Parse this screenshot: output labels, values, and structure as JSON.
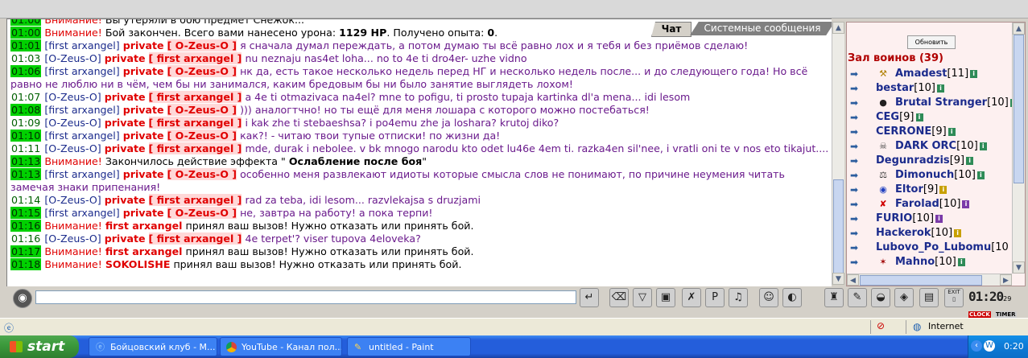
{
  "chat": {
    "tabs": {
      "chat": "Чат",
      "system": "Системные сообщения"
    },
    "lines": [
      {
        "time": "01:00",
        "warn": "Внимание!",
        "text": "Вы утеряли в бою предмет Снежок..."
      },
      {
        "time": "01:00",
        "warn": "Внимание!",
        "text_a": "Бой закончен. Всего вами нанесено урона:",
        "bold_a": "1129 HP",
        "text_b": ". Получено опыта:",
        "bold_b": "0",
        "text_c": "."
      },
      {
        "time": "01:01",
        "from": "[first arxangel]",
        "priv": "private",
        "to": "[ O-Zeus-O ]",
        "msg": "я сначала думал переждать, а потом думаю ты всё равно лох и я тебя и без приёмов сделаю!"
      },
      {
        "time": "01:03",
        "from": "[O-Zeus-O]",
        "priv": "private",
        "to": "[ first arxangel ]",
        "msg": "nu neznaju nas4et loha... no to 4e ti dro4er- uzhe vidno"
      },
      {
        "time": "01:06",
        "from": "[first arxangel]",
        "priv": "private",
        "to": "[ O-Zeus-O ]",
        "msg": "нк да, есть такое несколько недель перед НГ и несколько недель после... и до следующего года! Но всё равно не люблю ни в чём, чем бы ни занимался, каким бредовым бы ни было занятие выглядеть лохом!"
      },
      {
        "time": "01:07",
        "from": "[O-Zeus-O]",
        "priv": "private",
        "to": "[ first arxangel ]",
        "msg": "a 4e ti otmazivaca na4el? mne to pofigu, ti prosto tupaja kartinka dl'a mena... idi lesom"
      },
      {
        "time": "01:08",
        "from": "[first arxangel]",
        "priv": "private",
        "to": "[ O-Zeus-O ]",
        "msg": "))) аналогтчно! но ты ещё для меня лошара с которого можно постебаться!"
      },
      {
        "time": "01:09",
        "from": "[O-Zeus-O]",
        "priv": "private",
        "to": "[ first arxangel ]",
        "msg": "i kak zhe ti stebaeshsa? i po4emu zhe ja loshara? krutoj diko?"
      },
      {
        "time": "01:10",
        "from": "[first arxangel]",
        "priv": "private",
        "to": "[ O-Zeus-O ]",
        "msg": "как?! - читаю твои тупые отписки! по жизни да!"
      },
      {
        "time": "01:11",
        "from": "[O-Zeus-O]",
        "priv": "private",
        "to": "[ first arxangel ]",
        "msg": "mde, durak i nebolee. v bk mnogo narodu kto odet lu46e 4em ti. razka4en sil'nee, i vratli oni te v nos eto tikajut...."
      },
      {
        "time": "01:13",
        "warn": "Внимание!",
        "text_a": "Закончилось действие эффекта \"",
        "bold_a": "Ослабление после боя",
        "text_b": "\""
      },
      {
        "time": "01:13",
        "from": "[first arxangel]",
        "priv": "private",
        "to": "[ O-Zeus-O ]",
        "msg": "особенно меня развлекают идиоты которые смысла слов не понимают, по причине неумения читать замечая знаки припенания!"
      },
      {
        "time": "01:14",
        "from": "[O-Zeus-O]",
        "priv": "private",
        "to": "[ first arxangel ]",
        "msg": "rad za teba, idi lesom... razvlekajsa s druzjami"
      },
      {
        "time": "01:15",
        "from": "[first arxangel]",
        "priv": "private",
        "to": "[ O-Zeus-O ]",
        "msg": "не, завтра на работу! а пока терпи!"
      },
      {
        "time": "01:16",
        "warn": "Внимание!",
        "who": "first arxangel",
        "text_a": "принял ваш вызов! Нужно отказать или принять бой."
      },
      {
        "time": "01:16",
        "from": "[O-Zeus-O]",
        "priv": "private",
        "to": "[ first arxangel ]",
        "msg": "4e terpet'? viser tupova 4eloveka?"
      },
      {
        "time": "01:17",
        "warn": "Внимание!",
        "who": "first arxangel",
        "text_a": "принял ваш вызов! Нужно отказать или принять бой."
      },
      {
        "time": "01:18",
        "warn": "Внимание!",
        "who": "SOKOLISHE",
        "text_a": "принял ваш вызов! Нужно отказать или принять бой."
      }
    ]
  },
  "room": {
    "refresh_label": "Обновить",
    "title": "Зал воинов (39)",
    "users": [
      {
        "name": "Amadest",
        "level": "[11]"
      },
      {
        "name": "bestar",
        "level": "[10]"
      },
      {
        "name": "Brutal Stranger",
        "level": "[10]"
      },
      {
        "name": "CEG",
        "level": "[9]"
      },
      {
        "name": "CERRONE",
        "level": "[9]"
      },
      {
        "name": "DARK ORC",
        "level": "[10]"
      },
      {
        "name": "Degunradzis",
        "level": "[9]"
      },
      {
        "name": "Dimonuch",
        "level": "[10]"
      },
      {
        "name": "Eltor",
        "level": "[9]"
      },
      {
        "name": "Farolad",
        "level": "[10]"
      },
      {
        "name": "FURIO",
        "level": "[10]"
      },
      {
        "name": "Hackerok",
        "level": "[10]"
      },
      {
        "name": "Lubovo_Po_Lubomu",
        "level": "[10"
      },
      {
        "name": "Mahno",
        "level": "[10]"
      }
    ]
  },
  "toolbar": {
    "clock_time": "01:20",
    "clock_sec": "29",
    "clock_label": "CLOCK",
    "timer_label": "TIMER",
    "exit_label": "EXIT"
  },
  "statusbar": {
    "zone": "Internet"
  },
  "taskbar": {
    "start": "start",
    "items": [
      {
        "label": "Бойцовский клуб - M..."
      },
      {
        "label": "YouTube - Канал пол..."
      },
      {
        "label": "untitled - Paint"
      }
    ],
    "time": "0:20"
  }
}
